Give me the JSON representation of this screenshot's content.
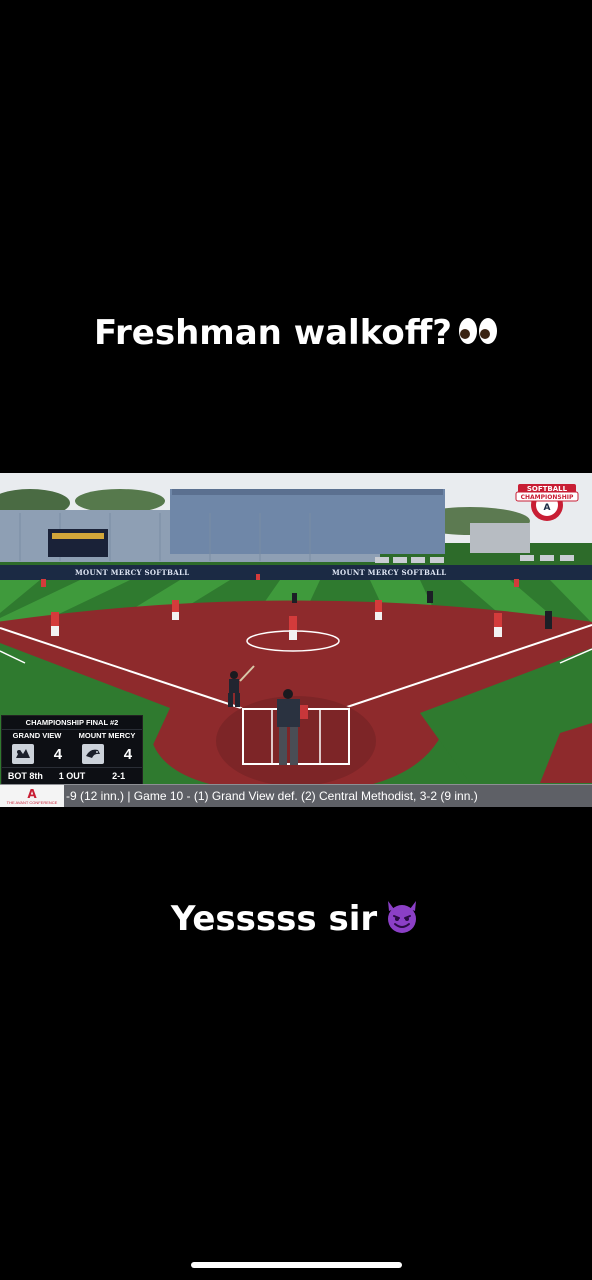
{
  "post": {
    "caption_top": "Freshman walkoff?",
    "caption_top_emoji": "eyes-emoji",
    "caption_bottom": "Yesssss sir",
    "caption_bottom_emoji": "smiling-devil-emoji"
  },
  "video": {
    "outfield_sign": "MOUNT MERCY SOFTBALL",
    "event_logo_line1": "SOFTBALL",
    "event_logo_line2": "CHAMPIONSHIP",
    "scorebug": {
      "title": "CHAMPIONSHIP FINAL #2",
      "away_team": "GRAND VIEW",
      "home_team": "MOUNT MERCY",
      "away_score": "4",
      "home_score": "4",
      "inning": "BOT 8th",
      "outs": "1 OUT",
      "count": "2-1"
    },
    "ticker": {
      "logo_letter": "A",
      "sponsor_text": "THE AVANT CONFERENCE",
      "text": "-9 (12 inn.) |  Game 10 - (1) Grand View def.  (2) Central Methodist, 3-2 (9 inn.)"
    }
  },
  "colors": {
    "background": "#000000",
    "grass_dark": "#2f7a2f",
    "grass_light": "#3f9a3c",
    "infield_clay": "#8e2a2c",
    "wall_navy": "#1b2a44",
    "ticker_bg": "#5e6066"
  }
}
